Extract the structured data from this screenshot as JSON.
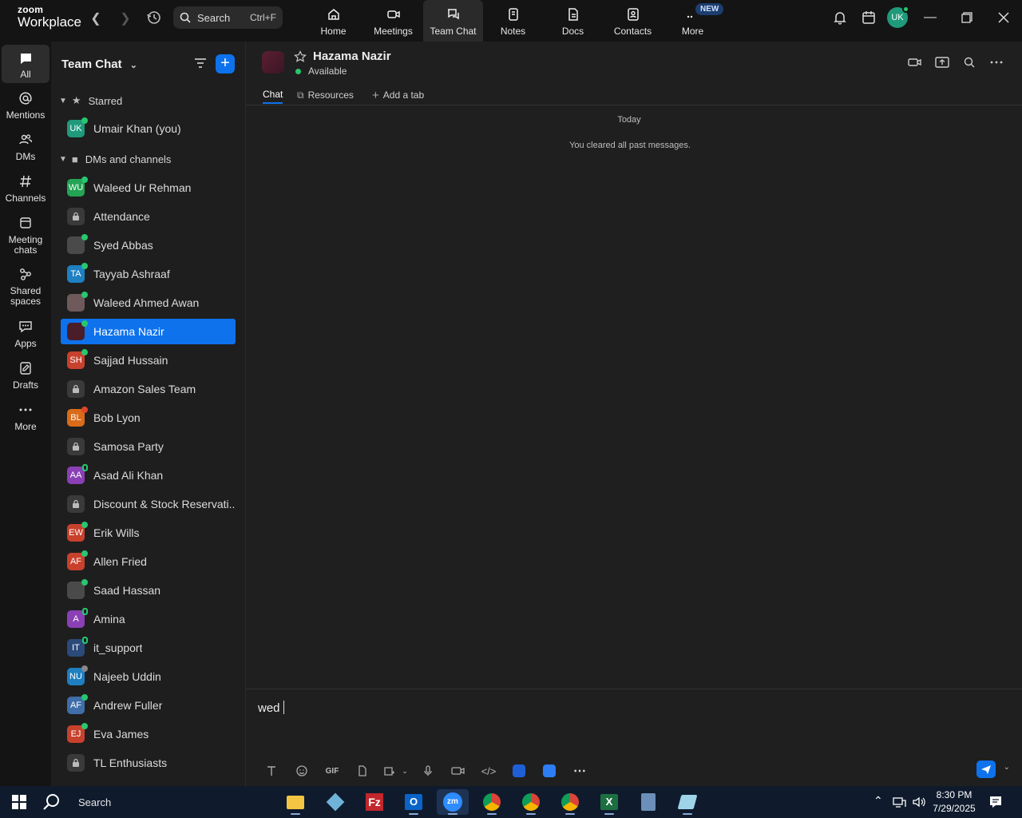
{
  "app": {
    "logo_line1": "zoom",
    "logo_line2": "Workplace"
  },
  "search": {
    "label": "Search",
    "shortcut": "Ctrl+F"
  },
  "topnav": [
    {
      "label": "Home",
      "icon": "home-icon"
    },
    {
      "label": "Meetings",
      "icon": "video-icon"
    },
    {
      "label": "Team Chat",
      "icon": "chat-icon",
      "active": true
    },
    {
      "label": "Notes",
      "icon": "notes-icon"
    },
    {
      "label": "Docs",
      "icon": "docs-icon"
    },
    {
      "label": "Contacts",
      "icon": "contacts-icon"
    },
    {
      "label": "More",
      "icon": "more-icon",
      "badge": "NEW"
    }
  ],
  "user": {
    "initials": "UK"
  },
  "rail": [
    {
      "label": "All",
      "icon": "chat-bubble-icon"
    },
    {
      "label": "Mentions",
      "icon": "at-icon"
    },
    {
      "label": "DMs",
      "icon": "people-icon"
    },
    {
      "label": "Channels",
      "icon": "hash-icon"
    },
    {
      "label": "Meeting chats",
      "icon": "calendar-icon"
    },
    {
      "label": "Shared spaces",
      "icon": "share-icon"
    },
    {
      "label": "Apps",
      "icon": "apps-icon"
    },
    {
      "label": "Drafts",
      "icon": "drafts-icon"
    },
    {
      "label": "More",
      "icon": "more-dots-icon"
    }
  ],
  "sidebar": {
    "title": "Team Chat",
    "starred_label": "Starred",
    "dms_label": "DMs and channels",
    "starred": [
      {
        "name": "Umair Khan (you)",
        "initials": "UK",
        "color": "#1f9a7b",
        "status": "on"
      }
    ],
    "items": [
      {
        "name": "Waleed Ur Rehman",
        "initials": "WU",
        "color": "#23a455",
        "status": "on"
      },
      {
        "name": "Attendance",
        "initials": "",
        "color": "#3a3a3a",
        "lock": true
      },
      {
        "name": "Syed Abbas",
        "initials": "",
        "color": "#4a4a4a",
        "status": "on",
        "photo": true
      },
      {
        "name": "Tayyab Ashraaf",
        "initials": "TA",
        "color": "#1e7fc1",
        "status": "on"
      },
      {
        "name": "Waleed Ahmed Awan",
        "initials": "",
        "color": "#6e5a5a",
        "status": "on",
        "photo": true
      },
      {
        "name": "Hazama Nazir",
        "initials": "",
        "color": "#4a1d2b",
        "status": "on",
        "selected": true
      },
      {
        "name": "Sajjad Hussain",
        "initials": "SH",
        "color": "#c7412d",
        "status": "on"
      },
      {
        "name": "Amazon Sales Team",
        "initials": "",
        "color": "#3a3a3a",
        "lock": true
      },
      {
        "name": "Bob Lyon",
        "initials": "BL",
        "color": "#d96b1a",
        "status": "busy"
      },
      {
        "name": "Samosa Party",
        "initials": "",
        "color": "#3a3a3a",
        "lock": true
      },
      {
        "name": "Asad Ali Khan",
        "initials": "AA",
        "color": "#8a3fb5",
        "status": "away"
      },
      {
        "name": "Discount & Stock Reservati...",
        "initials": "",
        "color": "#3a3a3a",
        "lock": true
      },
      {
        "name": "Erik Wills",
        "initials": "EW",
        "color": "#c7412d",
        "status": "on"
      },
      {
        "name": "Allen Fried",
        "initials": "AF",
        "color": "#c7412d",
        "status": "on"
      },
      {
        "name": "Saad Hassan",
        "initials": "",
        "color": "#4a4a4a",
        "status": "on",
        "photo": true
      },
      {
        "name": "Amina",
        "initials": "A",
        "color": "#8a3fb5",
        "status": "away"
      },
      {
        "name": "it_support",
        "initials": "IT",
        "color": "#2b4a7a",
        "status": "away"
      },
      {
        "name": "Najeeb Uddin",
        "initials": "NU",
        "color": "#1e7fc1",
        "status": "off"
      },
      {
        "name": "Andrew Fuller",
        "initials": "AF",
        "color": "#3f6ea8",
        "status": "on"
      },
      {
        "name": "Eva James",
        "initials": "EJ",
        "color": "#c7412d",
        "status": "on"
      },
      {
        "name": "TL Enthusiasts",
        "initials": "",
        "color": "#3a3a3a",
        "lock": true
      }
    ]
  },
  "chat": {
    "name": "Hazama Nazir",
    "status": "Available",
    "tabs": [
      "Chat",
      "Resources",
      "Add a tab"
    ],
    "day_label": "Today",
    "system_message": "You cleared all past messages.",
    "composer_text": "wed"
  },
  "taskbar": {
    "search_label": "Search",
    "time": "8:30 PM",
    "date": "7/29/2025"
  }
}
